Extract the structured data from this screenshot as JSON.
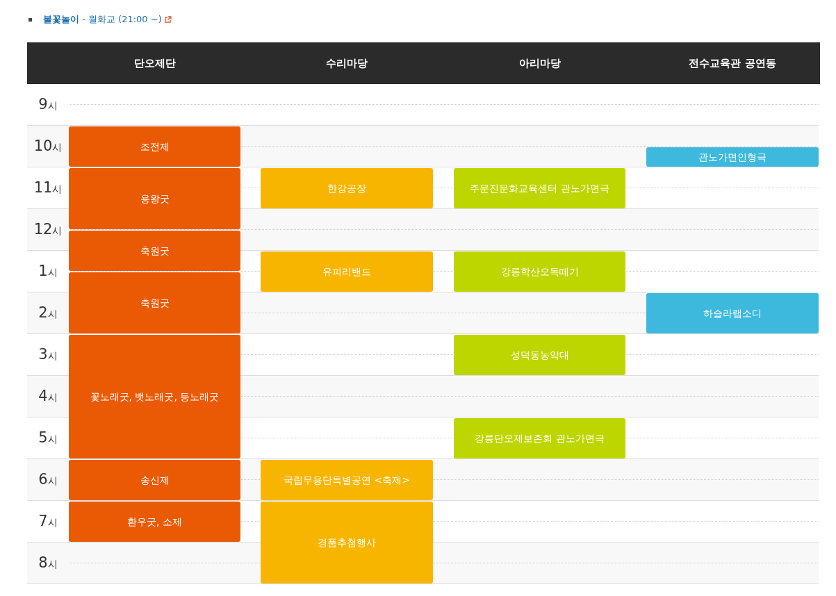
{
  "notice": {
    "text": "**불꽃놀이** - 월화교 (21:00 ~)"
  },
  "venues": [
    {
      "name": "단오제단",
      "color": "#ea5a05",
      "slots": [
        {
          "kind": "empty"
        },
        {
          "kind": "empty"
        },
        {
          "kind": "event",
          "title": "조전제"
        },
        {
          "kind": "more"
        },
        {
          "kind": "event",
          "title": "용왕굿"
        },
        {
          "kind": "more"
        },
        {
          "kind": "more"
        },
        {
          "kind": "event",
          "title": "축원굿"
        },
        {
          "kind": "more"
        },
        {
          "kind": "event",
          "title": "축원굿"
        },
        {
          "kind": "more"
        },
        {
          "kind": "more"
        },
        {
          "kind": "event",
          "title": "꽃노래굿, 뱃노래굿, 등노래굿"
        },
        {
          "kind": "more"
        },
        {
          "kind": "more"
        },
        {
          "kind": "more"
        },
        {
          "kind": "more"
        },
        {
          "kind": "more"
        },
        {
          "kind": "event",
          "title": "송신제"
        },
        {
          "kind": "more"
        },
        {
          "kind": "event",
          "title": "환우굿, 소제"
        },
        {
          "kind": "more"
        }
      ]
    },
    {
      "name": "수리마당",
      "color": "#f8b500",
      "slots": [
        {
          "kind": "empty"
        },
        {
          "kind": "empty"
        },
        {
          "kind": "empty"
        },
        {
          "kind": "empty"
        },
        {
          "kind": "event",
          "title": "한강공장"
        },
        {
          "kind": "more"
        },
        {
          "kind": "empty"
        },
        {
          "kind": "empty"
        },
        {
          "kind": "event",
          "title": "유피리밴드"
        },
        {
          "kind": "more"
        },
        {
          "kind": "empty"
        },
        {
          "kind": "empty"
        },
        {
          "kind": "empty"
        },
        {
          "kind": "empty"
        },
        {
          "kind": "empty"
        },
        {
          "kind": "empty"
        },
        {
          "kind": "empty"
        },
        {
          "kind": "empty"
        },
        {
          "kind": "event",
          "title": "국립무용단특별공연 <축제>"
        },
        {
          "kind": "more"
        },
        {
          "kind": "event",
          "title": "경품추첨행사"
        },
        {
          "kind": "more"
        },
        {
          "kind": "more"
        },
        {
          "kind": "more"
        }
      ]
    },
    {
      "name": "아리마당",
      "color": "#bed600",
      "slots": [
        {
          "kind": "empty"
        },
        {
          "kind": "empty"
        },
        {
          "kind": "empty"
        },
        {
          "kind": "empty"
        },
        {
          "kind": "event",
          "title": "주문진문화교육센터 관노가면극"
        },
        {
          "kind": "more"
        },
        {
          "kind": "empty"
        },
        {
          "kind": "empty"
        },
        {
          "kind": "event",
          "title": "강릉학산오독떼기"
        },
        {
          "kind": "more"
        },
        {
          "kind": "empty"
        },
        {
          "kind": "empty"
        },
        {
          "kind": "event",
          "title": "성덕동농악대"
        },
        {
          "kind": "more"
        },
        {
          "kind": "empty"
        },
        {
          "kind": "empty"
        },
        {
          "kind": "event",
          "title": "강릉단오제보존회 관노가면극"
        },
        {
          "kind": "more"
        }
      ]
    },
    {
      "name": "전수교육관 공연동",
      "color": "#3cb9dc",
      "slots": [
        {
          "kind": "empty"
        },
        {
          "kind": "empty"
        },
        {
          "kind": "empty"
        },
        {
          "kind": "event",
          "title": "관노가면인형극"
        },
        {
          "kind": "empty"
        },
        {
          "kind": "empty"
        },
        {
          "kind": "empty"
        },
        {
          "kind": "empty"
        },
        {
          "kind": "empty"
        },
        {
          "kind": "empty"
        },
        {
          "kind": "event",
          "title": "하슬라랩소디"
        },
        {
          "kind": "more"
        }
      ]
    }
  ],
  "hours": [
    {
      "hour": "9",
      "suffix": "시"
    },
    {
      "hour": "10",
      "suffix": "시"
    },
    {
      "hour": "11",
      "suffix": "시"
    },
    {
      "hour": "12",
      "suffix": "시"
    },
    {
      "hour": "1",
      "suffix": "시"
    },
    {
      "hour": "2",
      "suffix": "시"
    },
    {
      "hour": "3",
      "suffix": "시"
    },
    {
      "hour": "4",
      "suffix": "시"
    },
    {
      "hour": "5",
      "suffix": "시"
    },
    {
      "hour": "6",
      "suffix": "시"
    },
    {
      "hour": "7",
      "suffix": "시"
    },
    {
      "hour": "8",
      "suffix": "시"
    }
  ]
}
